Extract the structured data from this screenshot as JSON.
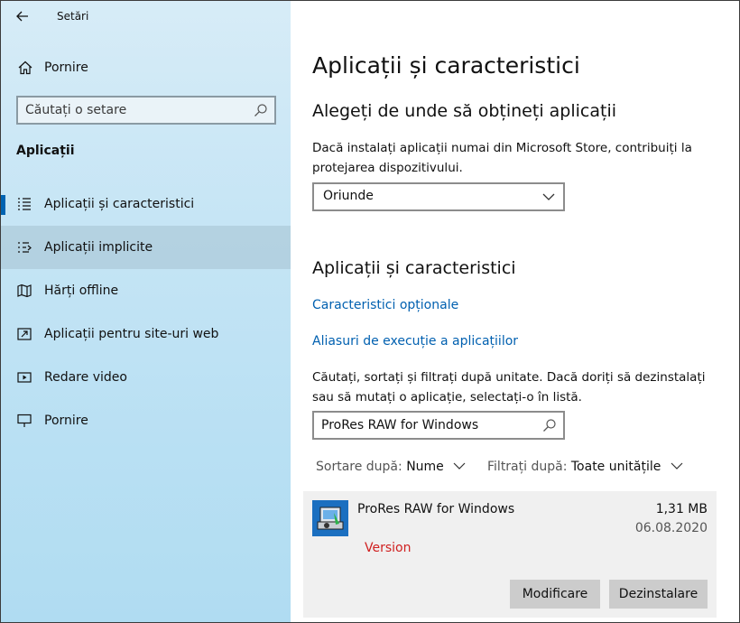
{
  "window": {
    "title": "Setări"
  },
  "sidebar": {
    "home_label": "Pornire",
    "search_placeholder": "Căutați o setare",
    "section_title": "Aplicații",
    "items": [
      {
        "label": "Aplicații și caracteristici",
        "icon": "apps-list-icon",
        "selected": true
      },
      {
        "label": "Aplicații implicite",
        "icon": "default-apps-icon",
        "hover": true
      },
      {
        "label": "Hărți offline",
        "icon": "map-icon"
      },
      {
        "label": "Aplicații pentru site-uri web",
        "icon": "web-app-icon"
      },
      {
        "label": "Redare video",
        "icon": "video-icon"
      },
      {
        "label": "Pornire",
        "icon": "startup-icon"
      }
    ]
  },
  "main": {
    "title": "Aplicații și caracteristici",
    "source_heading": "Alegeți de unde să obțineți aplicații",
    "source_desc": "Dacă instalați aplicații numai din Microsoft Store, contribuiți la protejarea dispozitivului.",
    "source_dropdown_value": "Oriunde",
    "apps_heading": "Aplicații și caracteristici",
    "link_optional": "Caracteristici opționale",
    "link_aliases": "Aliasuri de execuție a aplicațiilor",
    "search_desc": "Căutați, sortați și filtrați după unitate. Dacă doriți să dezinstalați sau să mutați o aplicație, selectați-o în listă.",
    "search_value": "ProRes RAW for Windows",
    "sort_label": "Sortare după:",
    "sort_value": "Nume",
    "filter_label": "Filtrați după:",
    "filter_value": "Toate unitățile",
    "app": {
      "name": "ProRes RAW for Windows",
      "size": "1,31 MB",
      "date": "06.08.2020",
      "version": "Version",
      "modify_label": "Modificare",
      "uninstall_label": "Dezinstalare"
    }
  },
  "colors": {
    "accent": "#0063b1",
    "link": "#0060b0",
    "version_text": "#d02020",
    "button_bg": "#cccccc",
    "card_bg": "#f0f0f0"
  }
}
